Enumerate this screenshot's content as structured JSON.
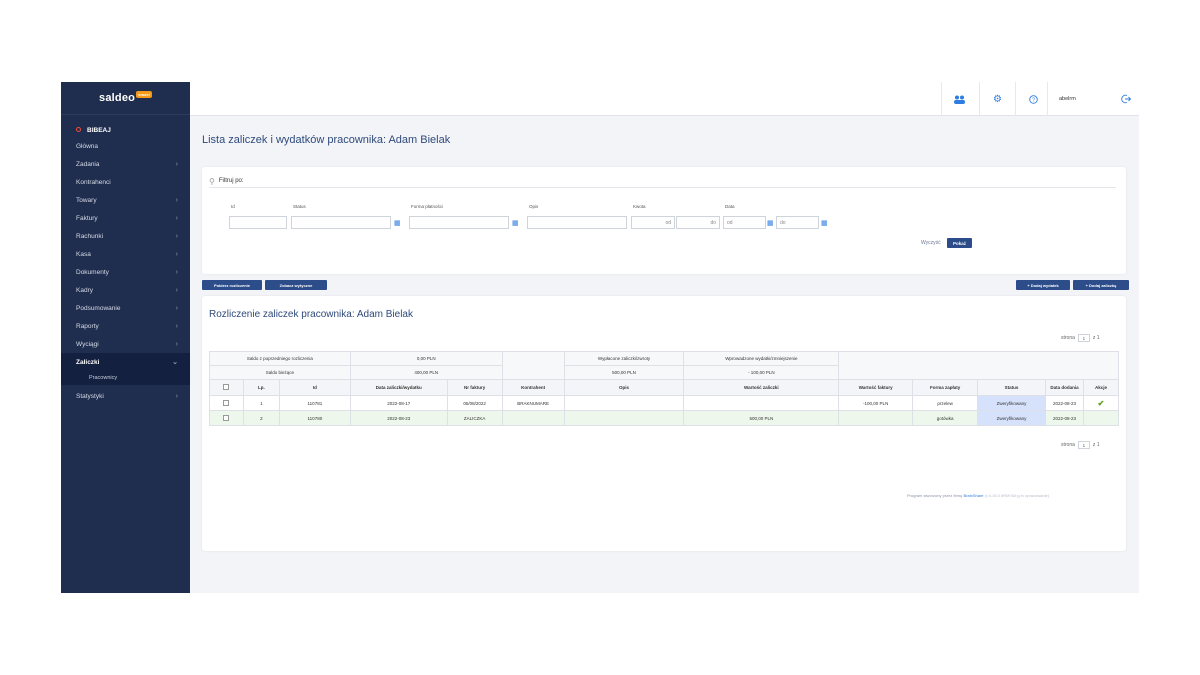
{
  "sidebar": {
    "logo": "saldeo",
    "logo_badge": "smart",
    "items": [
      {
        "label": "BIBEAJ",
        "has_children": false
      },
      {
        "label": "Główna",
        "has_children": false
      },
      {
        "label": "Zadania",
        "has_children": true
      },
      {
        "label": "Kontrahenci",
        "has_children": false
      },
      {
        "label": "Towary",
        "has_children": true
      },
      {
        "label": "Faktury",
        "has_children": true
      },
      {
        "label": "Rachunki",
        "has_children": true
      },
      {
        "label": "Kasa",
        "has_children": true
      },
      {
        "label": "Dokumenty",
        "has_children": true
      },
      {
        "label": "Kadry",
        "has_children": true
      },
      {
        "label": "Podsumowanie",
        "has_children": true
      },
      {
        "label": "Raporty",
        "has_children": true
      },
      {
        "label": "Wyciągi",
        "has_children": true
      },
      {
        "label": "Zaliczki",
        "has_children": true
      },
      {
        "label": "Pracownicy",
        "has_children": false
      },
      {
        "label": "Statystyki",
        "has_children": true
      }
    ]
  },
  "topbar": {
    "icons": [
      "users-icon",
      "settings-icon",
      "help-icon"
    ],
    "username": "abelrm",
    "logout_icon": "logout-icon"
  },
  "page_title": "Lista zaliczek i wydatków pracownika: Adam Bielak",
  "filter": {
    "search_label": "Filtruj po:",
    "fields": [
      {
        "label": "Id",
        "value": ""
      },
      {
        "label": "Status",
        "value": ""
      },
      {
        "label": "Forma płatności",
        "value": ""
      },
      {
        "label": "Opis",
        "value": ""
      },
      {
        "label": "Kwota",
        "from": "od",
        "to": "do"
      },
      {
        "label": "Data",
        "from": "od",
        "to": "do"
      }
    ],
    "clear_label": "Wyczyść",
    "show_label": "Pokaż"
  },
  "actions": {
    "left": [
      "Pobierz rozliczenie",
      "Zobacz wytyczne"
    ],
    "right": [
      "+ Dodaj wydatek",
      "+ Dodaj zaliczkę"
    ]
  },
  "section_title": "Rozliczenie zaliczek pracownika: Adam Bielak",
  "pager": {
    "label": "strona",
    "page": "1",
    "of": "z 1"
  },
  "summary": {
    "row1": {
      "prev_label": "Saldo z poprzedniego rozliczenia",
      "prev_value": "0,00 PLN",
      "paid_label": "Wypłacone zaliczki/zwroty",
      "spent_label": "Wprowadzone wydatki/zmniejszenie"
    },
    "row2": {
      "current_label": "Saldo bieżące",
      "current_value": "400,00 PLN",
      "paid_value": "500,00 PLN",
      "spent_value": "- 100,00 PLN"
    }
  },
  "table": {
    "headers": [
      "",
      "Lp.",
      "Id",
      "Data zaliczki/wydatku",
      "Nr faktury",
      "Kontrahent",
      "Opis",
      "Wartość zaliczki",
      "Wartość faktury",
      "Forma zapłaty",
      "Status",
      "Data dodania",
      "Akcje"
    ],
    "rows": [
      {
        "lp": "1",
        "id": "110781",
        "date": "2022-08-17",
        "invoice": "05/08/2022",
        "contractor": "BRAKNUMARE",
        "desc": "",
        "advance": "",
        "invoice_value": "-100,00 PLN",
        "payment": "przelew",
        "status": "Zweryfikowany",
        "added": "2022-08-23",
        "action": "✔"
      },
      {
        "lp": "2",
        "id": "110780",
        "date": "2022-08-23",
        "invoice": "ZALICZKA",
        "contractor": "",
        "desc": "",
        "advance": "500,00 PLN",
        "invoice_value": "",
        "payment": "gotówka",
        "status": "Zweryfikowany",
        "added": "2022-08-23",
        "action": ""
      }
    ]
  },
  "footer": {
    "text": "Program stworzony przez firmę",
    "brand": "BrainShare",
    "version": "(v.4.16.0 #RM?&lt;g in opracowanie)"
  },
  "colors": {
    "sidebar": "#1f2d4f",
    "accent": "#2d4c8a",
    "link": "#2f7de1",
    "status_bg": "#d6e2fb",
    "row_alt": "#eef7ec"
  }
}
